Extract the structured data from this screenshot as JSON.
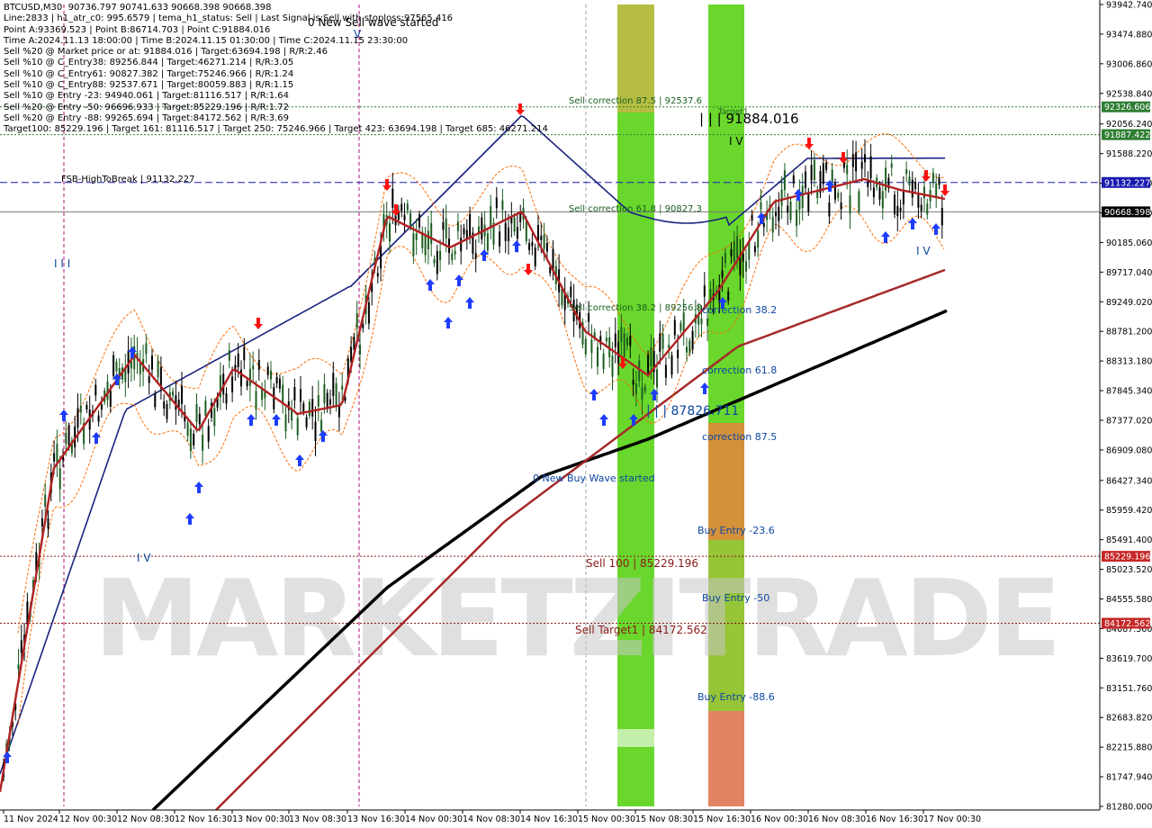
{
  "info_lines": [
    "BTCUSD,M30  90736.797 90741.633 90668.398 90668.398",
    "Line:2833 | h1_atr_c0: 995.6579 | tema_h1_status: Sell | Last Signal is:Sell with stoploss:97565.416",
    "Point A:93369.523 | Point B:86714.703 | Point C:91884.016",
    "Time A:2024.11.13 18:00:00 | Time B:2024.11.15 01:30:00 | Time C:2024.11.15 23:30:00",
    "Sell %20 @ Market price or at: 91884.016 | Target:63694.198 | R/R:2.46",
    "Sell %10 @ C_Entry38: 89256.844 | Target:46271.214 | R/R:3.05",
    "Sell %10 @ C_Entry61: 90827.382 | Target:75246.966 | R/R:1.24",
    "Sell %10 @ C_Entry88: 92537.671 | Target:80059.883 | R/R:1.15",
    "Sell %10 @ Entry -23: 94940.061 | Target:81116.517 | R/R:1.64",
    "Sell %20 @ Entry -50: 96696.933 | Target:85229.196 | R/R:1.72",
    "Sell %20 @ Entry -88: 99265.694 | Target:84172.562 | R/R:3.69",
    "Target100: 85229.196 | Target 161: 81116.517 | Target 250: 75246.966 | Target 423: 63694.198 | Target 685: 46271.214"
  ],
  "watermark": "MARKETZITRADE",
  "chart_data": {
    "type": "candlestick",
    "symbol": "BTCUSD",
    "timeframe": "M30",
    "ylim": [
      81280.0,
      93942.74
    ],
    "y_ticks": [
      "93942.740",
      "93474.880",
      "93006.860",
      "92538.840",
      "92056.240",
      "91588.220",
      "91120.200",
      "90652.180",
      "90185.060",
      "89717.040",
      "89249.020",
      "88781.200",
      "88313.180",
      "87845.340",
      "87377.020",
      "86909.080",
      "86427.340",
      "85959.420",
      "85491.400",
      "85023.520",
      "84555.580",
      "84087.560",
      "83619.700",
      "83151.760",
      "82683.820",
      "82215.880",
      "81747.940",
      "81280.000"
    ],
    "x_ticks": [
      "11 Nov 2024",
      "12 Nov 00:30",
      "12 Nov 08:30",
      "12 Nov 16:30",
      "13 Nov 00:30",
      "13 Nov 08:30",
      "13 Nov 16:30",
      "14 Nov 00:30",
      "14 Nov 08:30",
      "14 Nov 16:30",
      "15 Nov 00:30",
      "15 Nov 08:30",
      "15 Nov 16:30",
      "16 Nov 00:30",
      "16 Nov 08:30",
      "16 Nov 16:30",
      "17 Nov 00:30"
    ],
    "current_price": 90668.398,
    "price_badges": [
      {
        "value": "92326.606",
        "color": "#2e7d32"
      },
      {
        "value": "91887.422",
        "color": "#2e7d32"
      },
      {
        "value": "91132.227",
        "color": "#1a1ab0"
      },
      {
        "value": "90668.398",
        "color": "#000000"
      },
      {
        "value": "85229.196",
        "color": "#c62828"
      },
      {
        "value": "84172.562",
        "color": "#c62828"
      }
    ],
    "horizontal_levels": [
      {
        "value": 92326.606,
        "color": "#2e7d32",
        "style": "dotted"
      },
      {
        "value": 91887.422,
        "color": "#2e7d32",
        "style": "dotted"
      },
      {
        "value": 91132.227,
        "color": "#1a1ab0",
        "style": "dashed"
      },
      {
        "value": 90668.398,
        "color": "#777777",
        "style": "solid"
      },
      {
        "value": 85229.196,
        "color": "#8b1a1a",
        "style": "dotted"
      },
      {
        "value": 84172.562,
        "color": "#8b1a1a",
        "style": "dotted"
      }
    ],
    "annotations": [
      {
        "text": "0 New Sell wave started",
        "color": "#000000"
      },
      {
        "text": "Sell correction 87.5 | 92537.6",
        "color": "#1b5e20"
      },
      {
        "text": "| | | 91884.016",
        "color": "#000000"
      },
      {
        "text": "FSB-HighToBreak | 91132.227",
        "color": "#000000"
      },
      {
        "text": "Sell correction 61.8 | 90827.3",
        "color": "#1b5e20"
      },
      {
        "text": "Sell correction 38.2 | 89256.8",
        "color": "#1b5e20"
      },
      {
        "text": "correction 38.2",
        "color": "#0d47a1"
      },
      {
        "text": "correction 61.8",
        "color": "#0d47a1"
      },
      {
        "text": "| | | 87826.711",
        "color": "#0d47a1"
      },
      {
        "text": "correction 87.5",
        "color": "#0d47a1"
      },
      {
        "text": "0 New Buy Wave started",
        "color": "#0d47a1"
      },
      {
        "text": "Buy Entry -23.6",
        "color": "#0d47a1"
      },
      {
        "text": "Sell 100 | 85229.196",
        "color": "#8b1a1a"
      },
      {
        "text": "Buy Entry -50",
        "color": "#0d47a1"
      },
      {
        "text": "Sell Target1 | 84172.562",
        "color": "#8b1a1a"
      },
      {
        "text": "Buy Entry -88.6",
        "color": "#0d47a1"
      },
      {
        "text": "I I I",
        "color": "#0d47a1"
      },
      {
        "text": "I V",
        "color": "#0d47a1"
      },
      {
        "text": "I V",
        "color": "#0d47a1"
      },
      {
        "text": "V",
        "color": "#0d47a1"
      },
      {
        "text": "I V",
        "color": "#000000"
      },
      {
        "text": "Target1",
        "color": "#1b5e20"
      }
    ],
    "zones": [
      {
        "name": "green-band-1",
        "color": "#5cd41a"
      },
      {
        "name": "green-band-2",
        "color": "#5cd41a"
      }
    ],
    "series": [
      {
        "color": "#b22222"
      },
      {
        "color": "#1a237e"
      },
      {
        "color": "#a52a2a"
      },
      {
        "color": "#000000"
      },
      {
        "color": "#ff6a00"
      }
    ],
    "candle_colors": {
      "up": "#1b5e20",
      "down": "#000000"
    },
    "grid": false
  }
}
